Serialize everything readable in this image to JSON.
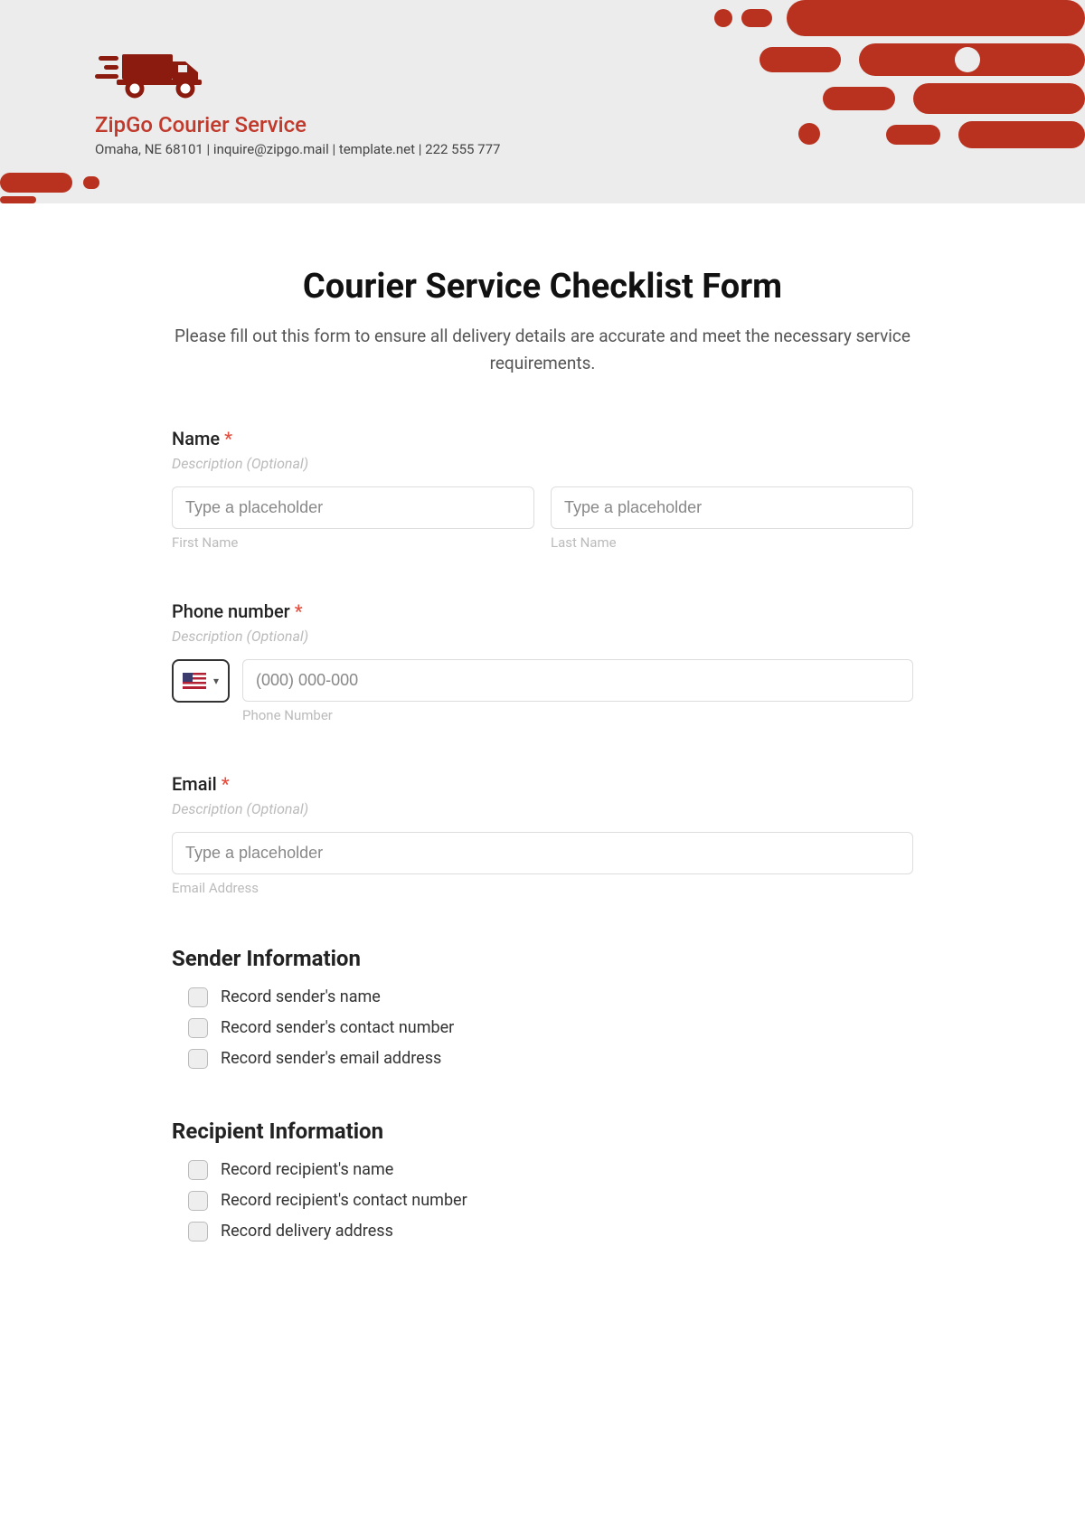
{
  "header": {
    "company_name": "ZipGo Courier Service",
    "company_info": "Omaha, NE 68101 | inquire@zipgo.mail | template.net | 222 555 777"
  },
  "form": {
    "title": "Courier Service Checklist Form",
    "subtitle": "Please fill out this form to ensure all delivery details are accurate and meet the necessary service requirements.",
    "name": {
      "label": "Name",
      "desc": "Description (Optional)",
      "first_placeholder": "Type a placeholder",
      "first_sub": "First Name",
      "last_placeholder": "Type a placeholder",
      "last_sub": "Last Name"
    },
    "phone": {
      "label": "Phone number",
      "desc": "Description (Optional)",
      "placeholder": "(000) 000-000",
      "sub": "Phone Number"
    },
    "email": {
      "label": "Email",
      "desc": "Description (Optional)",
      "placeholder": "Type a placeholder",
      "sub": "Email Address"
    },
    "sender": {
      "title": "Sender Information",
      "items": [
        "Record sender's name",
        "Record sender's contact number",
        "Record sender's email address"
      ]
    },
    "recipient": {
      "title": "Recipient Information",
      "items": [
        "Record recipient's name",
        "Record recipient's contact number",
        "Record delivery address"
      ]
    }
  }
}
